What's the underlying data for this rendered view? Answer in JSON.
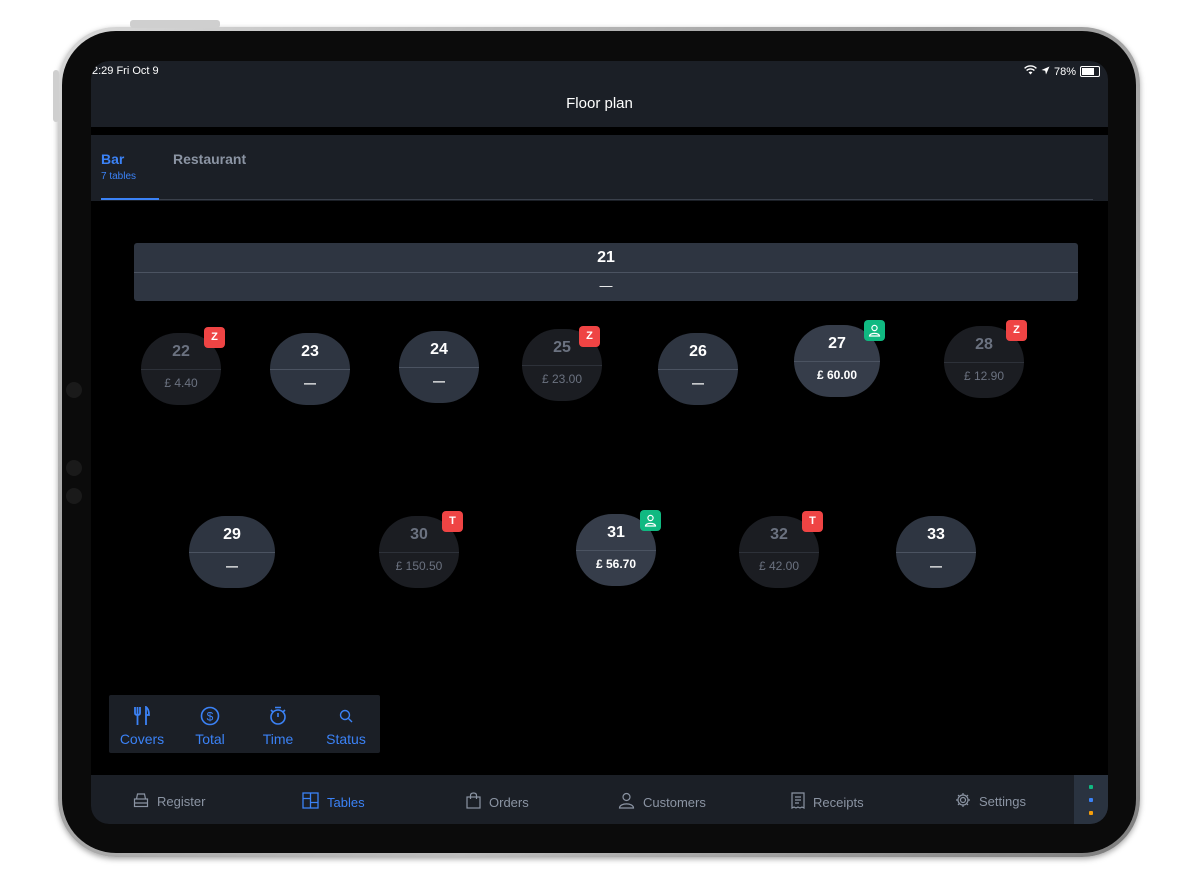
{
  "status_bar": {
    "time": "2:29  Fri Oct 9",
    "battery": "78%"
  },
  "nav": {
    "title": "Floor plan"
  },
  "areas": [
    {
      "label": "Bar",
      "sub": "7 tables"
    },
    {
      "label": "Restaurant"
    }
  ],
  "long_table": {
    "number": "21",
    "value": "—"
  },
  "tables": [
    {
      "number": "22",
      "value": "£ 4.40",
      "badge": "Z"
    },
    {
      "number": "23",
      "value": "—"
    },
    {
      "number": "24",
      "value": "—"
    },
    {
      "number": "25",
      "value": "£ 23.00",
      "badge": "Z"
    },
    {
      "number": "26",
      "value": "—"
    },
    {
      "number": "27",
      "value": "£ 60.00",
      "badge_icon": "person-icon"
    },
    {
      "number": "28",
      "value": "£ 12.90",
      "badge": "Z"
    },
    {
      "number": "29",
      "value": "—"
    },
    {
      "number": "30",
      "value": "£ 150.50",
      "badge": "T"
    },
    {
      "number": "31",
      "value": "£ 56.70",
      "badge_icon": "person-icon"
    },
    {
      "number": "32",
      "value": "£ 42.00",
      "badge": "T"
    },
    {
      "number": "33",
      "value": "—"
    }
  ],
  "view_options": [
    "Covers",
    "Total",
    "Time",
    "Status"
  ],
  "tab_bar": [
    {
      "label": "Register",
      "icon": "register-icon"
    },
    {
      "label": "Tables",
      "icon": "tables-icon",
      "active": true
    },
    {
      "label": "Orders",
      "icon": "bag-icon"
    },
    {
      "label": "Customers",
      "icon": "customers-icon"
    },
    {
      "label": "Receipts",
      "icon": "receipt-icon"
    },
    {
      "label": "Settings",
      "icon": "gear-icon"
    }
  ],
  "colors": {
    "accent": "#3b82f6",
    "badge_red": "#ef4444",
    "badge_green": "#10b981",
    "surface": "#1b1f26",
    "table": "#2e3541"
  }
}
